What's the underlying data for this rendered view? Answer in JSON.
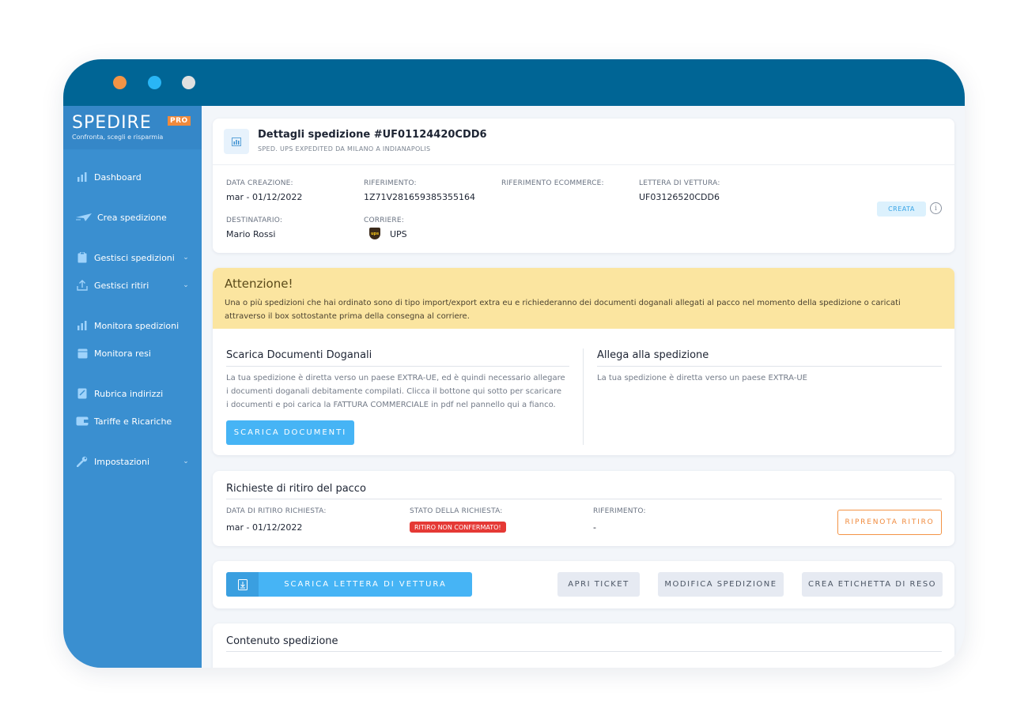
{
  "colors": {
    "titlebar": "#006595",
    "sidebar": "#3a8fd0",
    "accent": "#46b4f5",
    "warning_bg": "#fbe5a0",
    "danger": "#e53935",
    "orange": "#f08a3c"
  },
  "window": {
    "dots": [
      "#f39446",
      "#29b6f6",
      "#e0e0e0"
    ]
  },
  "sidebar": {
    "logo": {
      "brand": "SPEDIRE",
      "badge": "PRO",
      "tagline": "Confronta, scegli e risparmia"
    },
    "items": [
      {
        "label": "Dashboard",
        "icon": "bar-chart-icon"
      },
      {
        "label": "Crea spedizione",
        "icon": "paper-plane-icon"
      },
      {
        "label": "Gestisci spedizioni",
        "icon": "clipboard-icon",
        "chevron": "⌄"
      },
      {
        "label": "Gestisci ritiri",
        "icon": "upload-icon",
        "chevron": "⌄"
      },
      {
        "label": "Monitora spedizioni",
        "icon": "bar-chart-icon"
      },
      {
        "label": "Monitora resi",
        "icon": "box-icon"
      },
      {
        "label": "Rubrica indirizzi",
        "icon": "address-book-icon"
      },
      {
        "label": "Tariffe e Ricariche",
        "icon": "wallet-icon"
      },
      {
        "label": "Impostazioni",
        "icon": "wrench-icon",
        "chevron": "⌄"
      }
    ]
  },
  "details": {
    "title": "Dettagli spedizione #UF01124420CDD6",
    "subtitle": "SPED. UPS EXPEDITED DA MILANO A INDIANAPOLIS",
    "fields": {
      "creation_label": "DATA CREAZIONE:",
      "creation_value": "mar - 01/12/2022",
      "reference_label": "RIFERIMENTO:",
      "reference_value": "1Z71V281659385355164",
      "ecommerce_label": "RIFERIMENTO ECOMMERCE:",
      "waybill_label": "LETTERA DI VETTURA:",
      "waybill_value": "UF03126520CDD6",
      "recipient_label": "DESTINATARIO:",
      "recipient_value": "Mario Rossi",
      "courier_label": "CORRIERE:",
      "courier_value": "UPS",
      "courier_logo": "ups"
    },
    "status": "CREATA",
    "info_icon": "i"
  },
  "warning": {
    "title": "Attenzione!",
    "text": "Una o più spedizioni che hai ordinato sono di tipo import/export extra eu e richiederanno dei documenti doganali allegati al pacco nel momento della spedizione o caricati attraverso il box sottostante prima della consegna al corriere.",
    "left": {
      "title": "Scarica Documenti Doganali",
      "text": "La tua spedizione è diretta verso un paese EXTRA-UE, ed è quindi necessario allegare i documenti doganali debitamente compilati. Clicca il bottone qui sotto per scaricare i documenti e poi carica la FATTURA COMMERCIALE in pdf nel pannello qui a fianco.",
      "button": "SCARICA DOCUMENTI"
    },
    "right": {
      "title": "Allega alla spedizione",
      "text": "La tua spedizione è diretta verso un paese EXTRA-UE"
    }
  },
  "pickup": {
    "title": "Richieste di ritiro del pacco",
    "date_label": "DATA DI RITIRO RICHIESTA:",
    "date_value": "mar - 01/12/2022",
    "state_label": "STATO DELLA RICHIESTA:",
    "state_value": "RITIRO NON CONFERMATO!",
    "ref_label": "RIFERIMENTO:",
    "ref_value": "-",
    "rebook_button": "RIPRENOTA RITIRO"
  },
  "actions": {
    "download_waybill": "SCARICA LETTERA DI VETTURA",
    "open_ticket": "APRI TICKET",
    "edit_shipment": "MODIFICA SPEDIZIONE",
    "return_label": "CREA ETICHETTA DI RESO"
  },
  "contents": {
    "title": "Contenuto spedizione"
  }
}
